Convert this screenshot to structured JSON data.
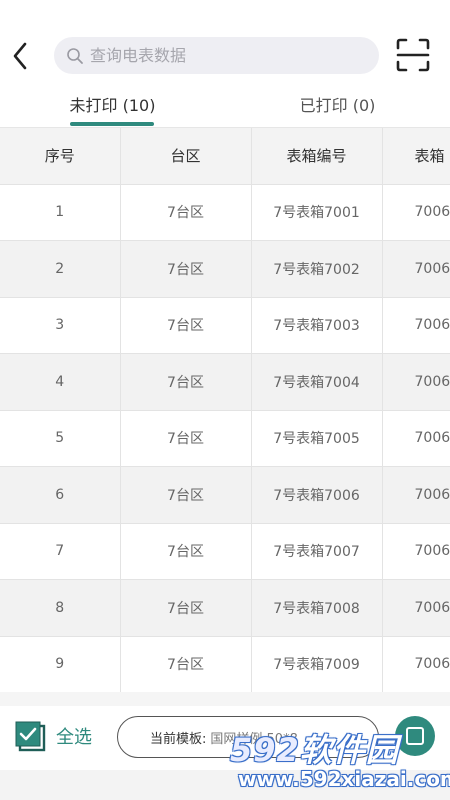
{
  "header": {
    "search_placeholder": "查询电表数据"
  },
  "tabs": [
    {
      "label": "未打印 (10)",
      "active": true
    },
    {
      "label": "已打印 (0)",
      "active": false
    }
  ],
  "table": {
    "columns": [
      "序号",
      "台区",
      "表箱编号",
      "表箱"
    ],
    "rows": [
      [
        "1",
        "7台区",
        "7号表箱7001",
        "7006"
      ],
      [
        "2",
        "7台区",
        "7号表箱7002",
        "7006"
      ],
      [
        "3",
        "7台区",
        "7号表箱7003",
        "7006"
      ],
      [
        "4",
        "7台区",
        "7号表箱7004",
        "7006"
      ],
      [
        "5",
        "7台区",
        "7号表箱7005",
        "7006"
      ],
      [
        "6",
        "7台区",
        "7号表箱7006",
        "7006"
      ],
      [
        "7",
        "7台区",
        "7号表箱7007",
        "7006"
      ],
      [
        "8",
        "7台区",
        "7号表箱7008",
        "7006"
      ],
      [
        "9",
        "7台区",
        "7号表箱7009",
        "7006"
      ]
    ]
  },
  "footer": {
    "select_all_label": "全选",
    "select_all_checked": true,
    "template_label": "当前模板:",
    "template_value": "国网样例 50*8"
  },
  "watermark": {
    "brand_num": "592",
    "brand_text": "软件园",
    "url": "www.592xiazai.com"
  },
  "colors": {
    "accent": "#2f8a7e",
    "search_bg": "#eeeef3",
    "header_row_bg": "#f3f3f3",
    "stripe_bg": "#f2f2f2"
  }
}
